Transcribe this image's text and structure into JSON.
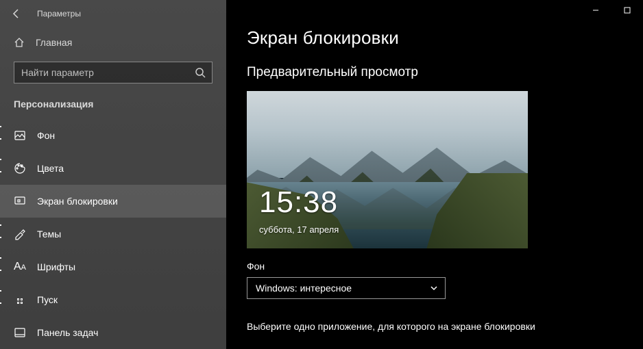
{
  "window": {
    "title": "Параметры"
  },
  "sidebar": {
    "home_label": "Главная",
    "search_placeholder": "Найти параметр",
    "category": "Персонализация",
    "items": [
      {
        "label": "Фон",
        "icon": "picture-icon",
        "selected": false
      },
      {
        "label": "Цвета",
        "icon": "palette-icon",
        "selected": false
      },
      {
        "label": "Экран блокировки",
        "icon": "lock-screen-icon",
        "selected": true
      },
      {
        "label": "Темы",
        "icon": "themes-icon",
        "selected": false
      },
      {
        "label": "Шрифты",
        "icon": "fonts-icon",
        "selected": false
      },
      {
        "label": "Пуск",
        "icon": "start-icon",
        "selected": false
      },
      {
        "label": "Панель задач",
        "icon": "taskbar-icon",
        "selected": false
      }
    ]
  },
  "main": {
    "title": "Экран блокировки",
    "preview_heading": "Предварительный просмотр",
    "clock": "15:38",
    "date": "суббота, 17 апреля",
    "background_label": "Фон",
    "background_dropdown": {
      "selected": "Windows: интересное"
    },
    "truncated_line": "Выберите одно приложение, для которого на экране блокировки"
  }
}
